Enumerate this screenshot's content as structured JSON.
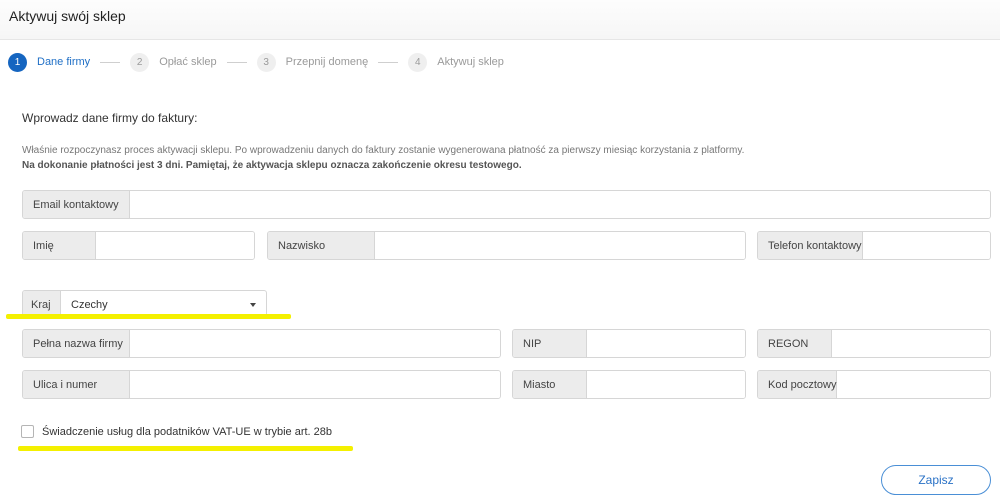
{
  "header": {
    "title": "Aktywuj swój sklep"
  },
  "steps": [
    {
      "num": "1",
      "label": "Dane firmy"
    },
    {
      "num": "2",
      "label": "Opłać sklep"
    },
    {
      "num": "3",
      "label": "Przepnij domenę"
    },
    {
      "num": "4",
      "label": "Aktywuj sklep"
    }
  ],
  "form": {
    "heading": "Wprowadz dane firmy do faktury:",
    "info_line1": "Właśnie rozpoczynasz proces aktywacji sklepu. Po wprowadzeniu danych do faktury zostanie wygenerowana płatność za pierwszy miesiąc korzystania z platformy.",
    "info_line2": "Na dokonanie płatności jest 3 dni. Pamiętaj, że aktywacja sklepu oznacza zakończenie okresu testowego.",
    "email_label": "Email kontaktowy",
    "email_value": "",
    "first_name_label": "Imię",
    "first_name_value": "",
    "last_name_label": "Nazwisko",
    "last_name_value": "",
    "phone_label": "Telefon kontaktowy",
    "phone_value": "",
    "country_label": "Kraj",
    "country_value": "Czechy",
    "company_label": "Pełna nazwa firmy",
    "company_value": "",
    "nip_label": "NIP",
    "nip_value": "",
    "regon_label": "REGON",
    "regon_value": "",
    "street_label": "Ulica i numer",
    "street_value": "",
    "city_label": "Miasto",
    "city_value": "",
    "postal_label": "Kod pocztowy",
    "postal_value": "",
    "vat_checkbox_label": "Świadczenie usług dla podatników VAT-UE w trybie art. 28b",
    "vat_checked": false,
    "save_label": "Zapisz"
  },
  "colors": {
    "accent": "#1565c0",
    "highlight": "#f4f000"
  }
}
